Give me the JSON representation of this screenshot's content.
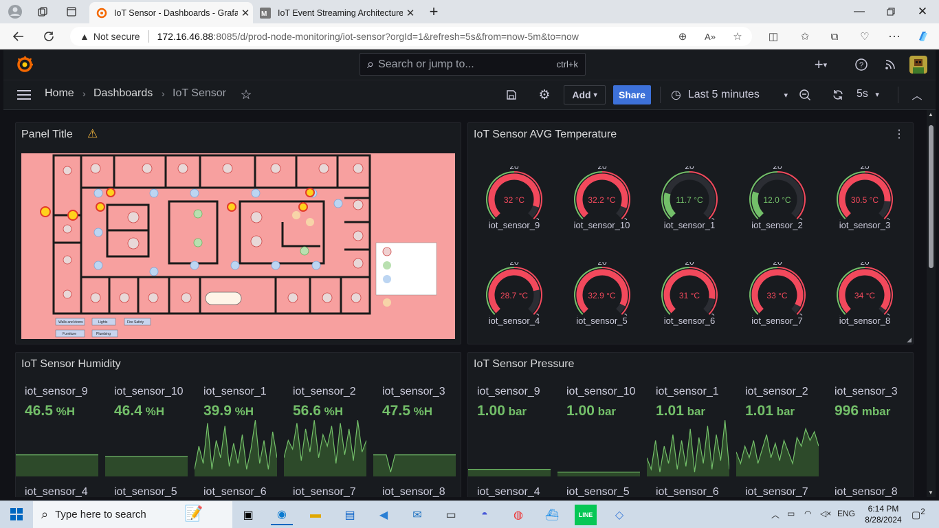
{
  "browser": {
    "tabs": [
      {
        "title": "IoT Sensor - Dashboards - Grafana",
        "active": true
      },
      {
        "title": "IoT Event Streaming Architecture",
        "active": false
      }
    ],
    "address": {
      "security": "Not secure",
      "host": "172.16.46.88",
      "path": ":8085/d/prod-node-monitoring/iot-sensor?orgId=1&refresh=5s&from=now-5m&to=now"
    }
  },
  "grafana": {
    "search_placeholder": "Search or jump to...",
    "search_shortcut": "ctrl+k",
    "breadcrumb": [
      "Home",
      "Dashboards",
      "IoT Sensor"
    ],
    "add_label": "Add",
    "share_label": "Share",
    "time_range": "Last 5 minutes",
    "refresh": "5s"
  },
  "panels": {
    "floorplan": {
      "title": "Panel Title",
      "legend": [
        "Walls and doors",
        "Lights",
        "Fire Safety",
        "Furniture",
        "Plumbing"
      ]
    },
    "temperature": {
      "title": "IoT Sensor AVG Temperature",
      "gauge_min": "5",
      "gauge_mid": "20",
      "gauge_max": "35",
      "min_value": 5,
      "max_value": 35,
      "threshold": 20,
      "colors": {
        "red": "#f2495c",
        "green": "#73bf69",
        "track": "#2b2d33"
      },
      "sensors": [
        {
          "name": "iot_sensor_9",
          "value": 32,
          "label": "32 °C"
        },
        {
          "name": "iot_sensor_10",
          "value": 32.2,
          "label": "32.2 °C"
        },
        {
          "name": "iot_sensor_1",
          "value": 11.7,
          "label": "11.7 °C"
        },
        {
          "name": "iot_sensor_2",
          "value": 12,
          "label": "12.0 °C"
        },
        {
          "name": "iot_sensor_3",
          "value": 30.5,
          "label": "30.5 °C"
        },
        {
          "name": "iot_sensor_4",
          "value": 28.7,
          "label": "28.7 °C"
        },
        {
          "name": "iot_sensor_5",
          "value": 32.9,
          "label": "32.9 °C"
        },
        {
          "name": "iot_sensor_6",
          "value": 31,
          "label": "31 °C"
        },
        {
          "name": "iot_sensor_7",
          "value": 33,
          "label": "33 °C"
        },
        {
          "name": "iot_sensor_8",
          "value": 34,
          "label": "34 °C"
        }
      ]
    },
    "humidity": {
      "title": "IoT Sensor Humidity",
      "row1": [
        {
          "name": "iot_sensor_9",
          "value": "46.5",
          "unit": "%H",
          "spark": [
            0.35,
            0.35,
            0.35,
            0.35,
            0.35,
            0.35,
            0.35,
            0.35,
            0.35,
            0.35,
            0.35,
            0.35,
            0.35,
            0.35,
            0.35,
            0.35,
            0.35,
            0.35,
            0.35,
            0.35
          ]
        },
        {
          "name": "iot_sensor_10",
          "value": "46.4",
          "unit": "%H",
          "spark": [
            0.32,
            0.32,
            0.32,
            0.32,
            0.32,
            0.32,
            0.32,
            0.32,
            0.32,
            0.32,
            0.32,
            0.32,
            0.32,
            0.32,
            0.32,
            0.32,
            0.32,
            0.32,
            0.32,
            0.32
          ]
        },
        {
          "name": "iot_sensor_1",
          "value": "39.9",
          "unit": "%H",
          "spark": [
            0.1,
            0.5,
            0.2,
            0.9,
            0.1,
            0.6,
            0.3,
            0.85,
            0.15,
            0.55,
            0.2,
            0.7,
            0.1,
            0.45,
            0.95,
            0.2,
            0.6,
            0.1,
            0.75,
            0.3
          ]
        },
        {
          "name": "iot_sensor_2",
          "value": "56.6",
          "unit": "%H",
          "spark": [
            0.3,
            0.6,
            0.45,
            0.9,
            0.25,
            0.8,
            0.4,
            0.95,
            0.3,
            0.7,
            0.5,
            0.85,
            0.2,
            0.9,
            0.35,
            0.8,
            0.25,
            0.95,
            0.4,
            0.6
          ]
        },
        {
          "name": "iot_sensor_3",
          "value": "47.5",
          "unit": "%H",
          "spark": [
            0.35,
            0.35,
            0.35,
            0.35,
            0.05,
            0.35,
            0.35,
            0.35,
            0.35,
            0.35,
            0.35,
            0.35,
            0.35,
            0.35,
            0.35,
            0.35,
            0.35,
            0.35,
            0.35,
            0.35
          ]
        }
      ],
      "row2": [
        "iot_sensor_4",
        "iot_sensor_5",
        "iot_sensor_6",
        "iot_sensor_7",
        "iot_sensor_8"
      ]
    },
    "pressure": {
      "title": "IoT Sensor Pressure",
      "row1": [
        {
          "name": "iot_sensor_9",
          "value": "1.00",
          "unit": "bar",
          "spark": [
            0.1,
            0.1,
            0.1,
            0.1,
            0.1,
            0.1,
            0.1,
            0.1,
            0.1,
            0.1,
            0.1,
            0.1,
            0.1,
            0.1,
            0.1,
            0.1,
            0.1,
            0.1,
            0.1,
            0.1
          ]
        },
        {
          "name": "iot_sensor_10",
          "value": "1.00",
          "unit": "bar",
          "spark": [
            0.05,
            0.05,
            0.05,
            0.05,
            0.05,
            0.05,
            0.05,
            0.05,
            0.05,
            0.05,
            0.05,
            0.05,
            0.05,
            0.05,
            0.05,
            0.05,
            0.05,
            0.05,
            0.05,
            0.05
          ]
        },
        {
          "name": "iot_sensor_1",
          "value": "1.01",
          "unit": "bar",
          "spark": [
            0.3,
            0.1,
            0.6,
            0.05,
            0.5,
            0.2,
            0.7,
            0.1,
            0.6,
            0.15,
            0.8,
            0.05,
            0.65,
            0.2,
            0.85,
            0.1,
            0.7,
            0.25,
            0.95,
            0.1
          ]
        },
        {
          "name": "iot_sensor_2",
          "value": "1.01",
          "unit": "bar",
          "spark": [
            0.4,
            0.2,
            0.5,
            0.3,
            0.6,
            0.2,
            0.45,
            0.7,
            0.3,
            0.55,
            0.25,
            0.6,
            0.4,
            0.2,
            0.65,
            0.5,
            0.8,
            0.6,
            0.75,
            0.5
          ]
        },
        {
          "name": "iot_sensor_3",
          "value": "996",
          "unit": "mbar",
          "spark": []
        }
      ],
      "row2": [
        "iot_sensor_4",
        "iot_sensor_5",
        "iot_sensor_6",
        "iot_sensor_7",
        "iot_sensor_8"
      ]
    }
  },
  "taskbar": {
    "search_placeholder": "Type here to search",
    "lang": "ENG",
    "time": "6:14 PM",
    "date": "8/28/2024",
    "notifications": "2"
  }
}
